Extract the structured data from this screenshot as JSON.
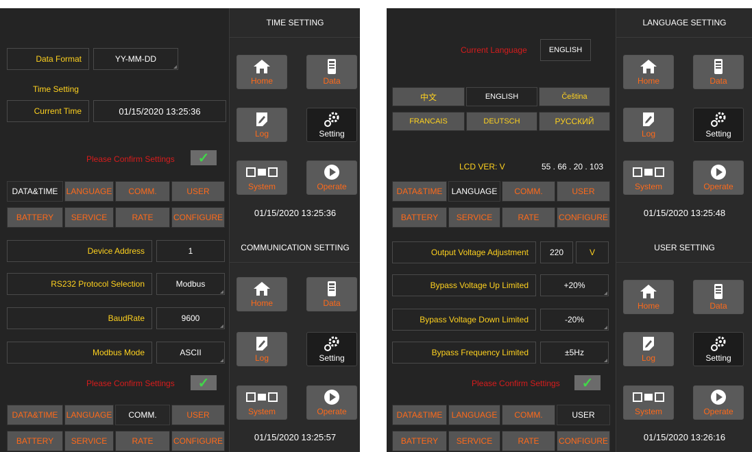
{
  "nav": {
    "home": "Home",
    "data": "Data",
    "log": "Log",
    "setting": "Setting",
    "system": "System",
    "operate": "Operate"
  },
  "tabs": {
    "row1": [
      "DATA&TIME",
      "LANGUAGE",
      "COMM.",
      "USER"
    ],
    "row2": [
      "BATTERY",
      "SERVICE",
      "RATE",
      "CONFIGURE"
    ]
  },
  "confirm": "Please Confirm Settings",
  "check_mark": "✓",
  "panel_time": {
    "header": "TIME SETTING",
    "data_format_label": "Data Format",
    "data_format_value": "YY-MM-DD",
    "time_setting_label": "Time Setting",
    "current_time_label": "Current Time",
    "current_time_value": "01/15/2020 13:25:36",
    "clock": "01/15/2020 13:25:36"
  },
  "panel_language": {
    "header": "LANGUAGE SETTING",
    "current_language_label": "Current Language",
    "current_language_value": "ENGLISH",
    "options_row1": [
      "中文",
      "ENGLISH",
      "Čeština"
    ],
    "options_row2": [
      "FRANCAIS",
      "DEUTSCH",
      "РУССКИЙ"
    ],
    "lcd_ver_label": "LCD VER:  V",
    "lcd_ver_value": "55 . 66 . 20 . 103",
    "clock": "01/15/2020 13:25:48"
  },
  "panel_comm": {
    "header": "COMMUNICATION SETTING",
    "device_address_label": "Device Address",
    "device_address_value": "1",
    "rs232_label": "RS232 Protocol Selection",
    "rs232_value": "Modbus",
    "baudrate_label": "BaudRate",
    "baudrate_value": "9600",
    "modbus_mode_label": "Modbus Mode",
    "modbus_mode_value": "ASCII",
    "clock": "01/15/2020 13:25:57"
  },
  "panel_user": {
    "header": "USER SETTING",
    "output_voltage_label": "Output Voltage Adjustment",
    "output_voltage_value": "220",
    "output_voltage_unit": "V",
    "bypass_up_label": "Bypass Voltage Up Limited",
    "bypass_up_value": "+20%",
    "bypass_down_label": "Bypass Voltage Down Limited",
    "bypass_down_value": "-20%",
    "bypass_freq_label": "Bypass Frequency Limited",
    "bypass_freq_value": "±5Hz",
    "clock": "01/15/2020 13:26:16"
  },
  "colors": {
    "background": "#242424",
    "label": "#ffd21f",
    "warning": "#d81c1c",
    "tab_text": "#ff6a1a",
    "check": "#42d64a"
  }
}
